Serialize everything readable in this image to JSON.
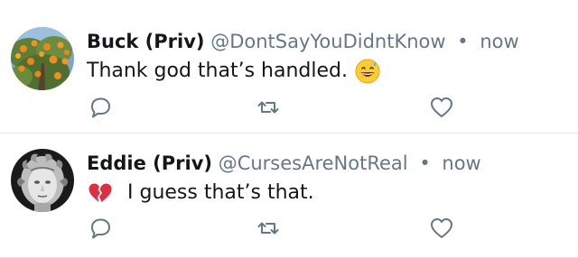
{
  "colors": {
    "handle_gray": "#657786",
    "text": "#14171a",
    "divider": "#e1e5e8",
    "icon_gray": "#657786"
  },
  "tweets": [
    {
      "name": "Buck (Priv)",
      "handle": "@DontSayYouDidntKnow",
      "separator": "•",
      "time": "now",
      "text": "Thank god that’s handled.",
      "avatar_icon": "orange-tree-avatar",
      "emoji": "grinning-face-with-sweat-emoji"
    },
    {
      "name": "Eddie (Priv)",
      "handle": "@CursesAreNotReal",
      "separator": "•",
      "time": "now",
      "text": "I guess that’s that.",
      "avatar_icon": "medusa-statue-avatar",
      "emoji": "broken-heart-emoji"
    }
  ],
  "actions": {
    "reply_icon": "reply-icon",
    "retweet_icon": "retweet-icon",
    "like_icon": "heart-icon"
  }
}
